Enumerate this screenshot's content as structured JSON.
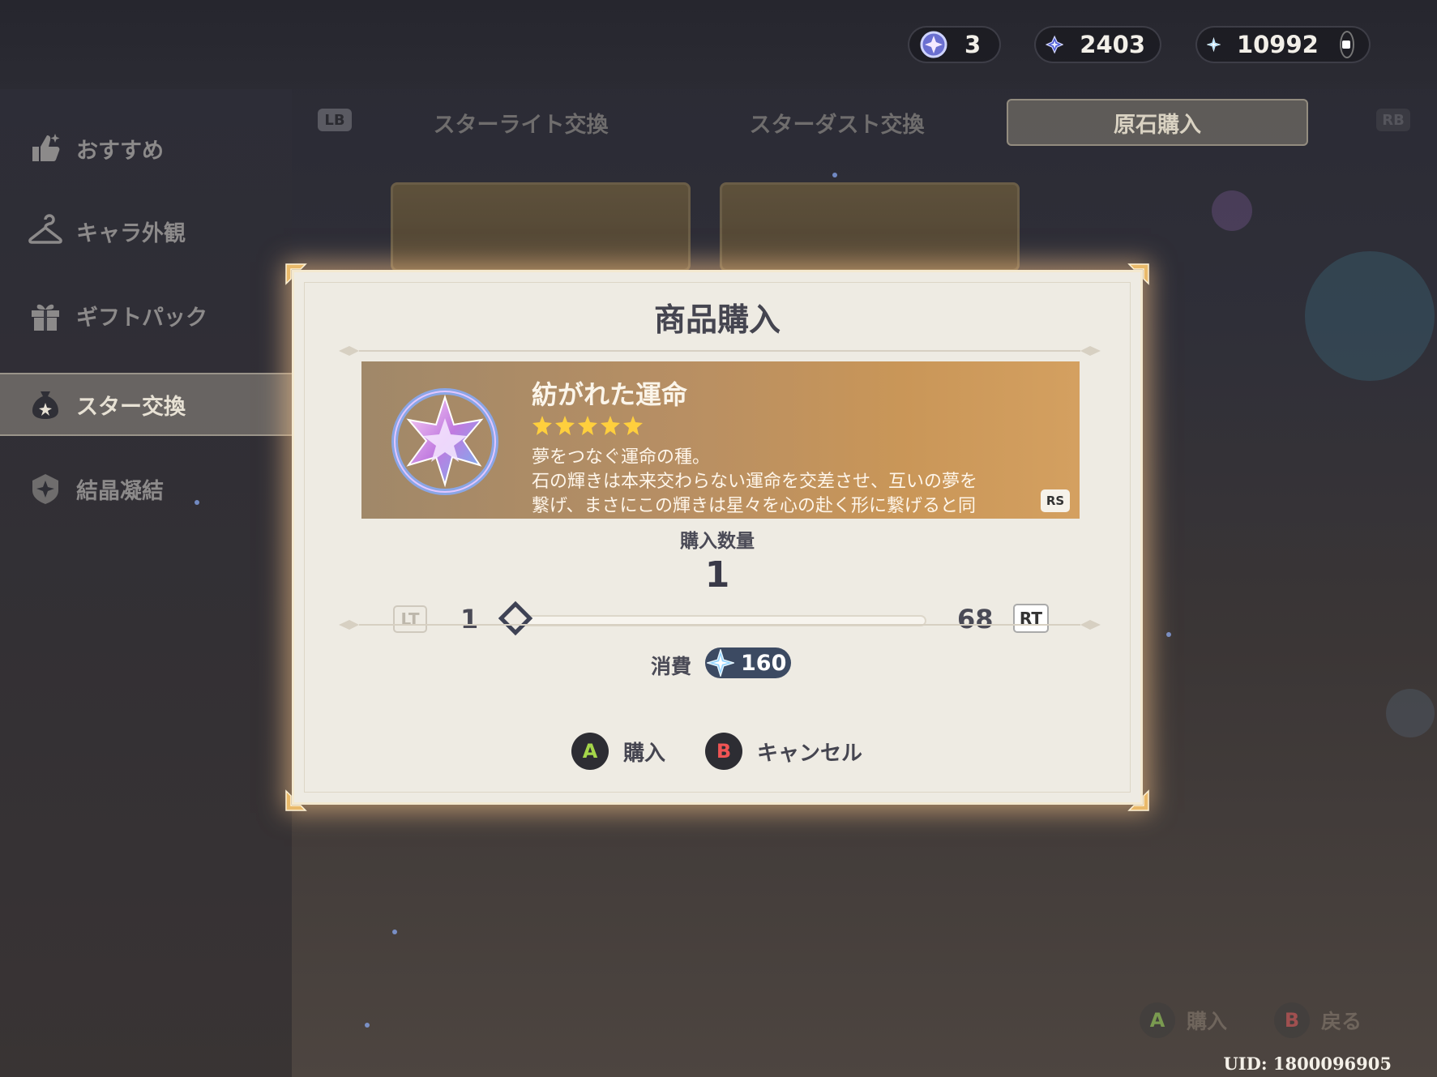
{
  "currencies": [
    {
      "icon": "intertwined-fate-icon",
      "value": "3"
    },
    {
      "icon": "starglitter-icon",
      "value": "2403"
    },
    {
      "icon": "primogem-icon",
      "value": "10992"
    }
  ],
  "sidebar": {
    "items": [
      {
        "label": "おすすめ",
        "icon": "thumbs-up-icon",
        "active": false
      },
      {
        "label": "キャラ外観",
        "icon": "hanger-icon",
        "active": false
      },
      {
        "label": "ギフトパック",
        "icon": "gift-icon",
        "active": false
      },
      {
        "label": "スター交換",
        "icon": "star-bag-icon",
        "active": true
      },
      {
        "label": "結晶凝結",
        "icon": "crystal-icon",
        "active": false
      }
    ]
  },
  "tabs": {
    "lb": "LB",
    "rb": "RB",
    "items": [
      {
        "label": "スターライト交換",
        "active": false
      },
      {
        "label": "スターダスト交換",
        "active": false
      },
      {
        "label": "原石購入",
        "active": true
      }
    ]
  },
  "dialog": {
    "title": "商品購入",
    "item": {
      "name": "紡がれた運命",
      "rarity": 5,
      "description_lines": [
        "夢をつなぐ運命の種。",
        "石の輝きは本来交わらない運命を交差させ、互いの夢を",
        "繋げ、まさにこの輝きは星々を心の赴く形に繋げると同"
      ],
      "scroll_key": "RS"
    },
    "quantity_label": "購入数量",
    "quantity": "1",
    "slider": {
      "lt": "LT",
      "rt": "RT",
      "min": "1",
      "max": "68",
      "fraction": 0
    },
    "cost_label": "消費",
    "cost_value": "160",
    "cost_icon": "primogem-icon",
    "confirm": {
      "key": "A",
      "label": "購入"
    },
    "cancel": {
      "key": "B",
      "label": "キャンセル"
    }
  },
  "bottom_hints": {
    "buy": {
      "key": "A",
      "label": "購入"
    },
    "back": {
      "key": "B",
      "label": "戻る"
    }
  },
  "uid": "UID: 1800096905",
  "colors": {
    "accent_gold": "#d4a060",
    "dialog_bg": "#eeebe3",
    "button_a_green": "#a5d64a",
    "button_b_red": "#f05454",
    "cost_pill": "#3c4a62"
  }
}
